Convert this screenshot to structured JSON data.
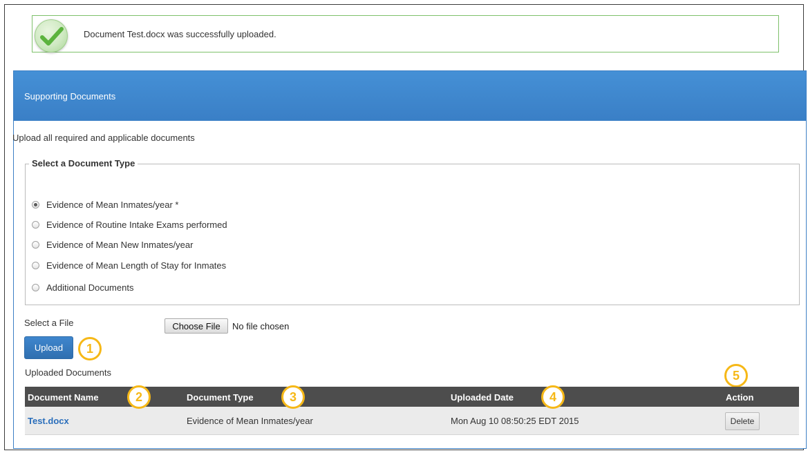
{
  "alert": {
    "icon": "check-circle-icon",
    "message": "Document Test.docx was successfully uploaded."
  },
  "panel": {
    "title": "Supporting Documents",
    "intro": "Upload all required and applicable documents"
  },
  "document_type": {
    "legend": "Select a Document Type",
    "options": [
      {
        "label": "Evidence of Mean Inmates/year *",
        "checked": true
      },
      {
        "label": "Evidence of Routine Intake Exams performed",
        "checked": false
      },
      {
        "label": "Evidence of Mean New Inmates/year",
        "checked": false
      },
      {
        "label": "Evidence of Mean Length of Stay for Inmates",
        "checked": false
      },
      {
        "label": "Additional Documents",
        "checked": false
      }
    ]
  },
  "file": {
    "label": "Select a File",
    "choose_label": "Choose File",
    "status": "No file chosen"
  },
  "upload_label": "Upload",
  "uploaded_label": "Uploaded Documents",
  "table": {
    "headers": [
      "Document Name",
      "Document Type",
      "Uploaded Date",
      "Action"
    ],
    "rows": [
      {
        "name": "Test.docx",
        "type": "Evidence of Mean Inmates/year",
        "date": "Mon Aug 10 08:50:25 EDT 2015",
        "action": "Delete"
      }
    ]
  },
  "callouts": [
    "1",
    "2",
    "3",
    "4",
    "5"
  ],
  "colors": {
    "panel_header": "#3f86cd",
    "callout": "#f6b817",
    "success_border": "#7dc06a",
    "table_header": "#4d4d4d",
    "link": "#2a6ebb"
  }
}
